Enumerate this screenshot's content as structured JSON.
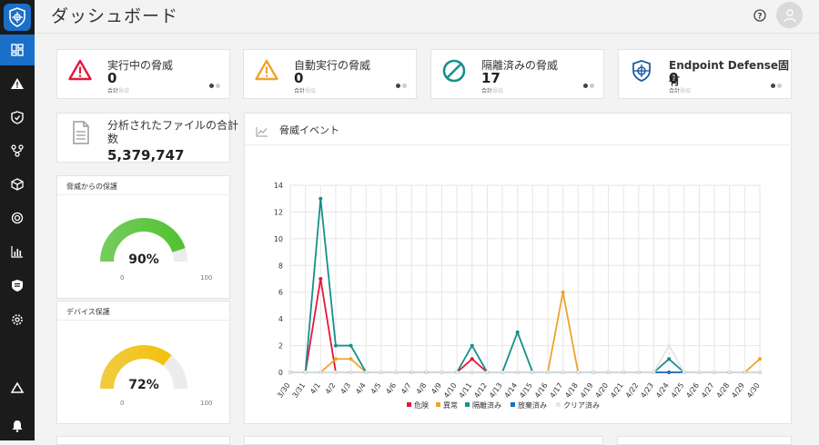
{
  "page": {
    "title": "ダッシュボード"
  },
  "stats": [
    {
      "label": "実行中の脅威",
      "value": "0",
      "sub": "合計",
      "sub_faded": "脅威",
      "icon": "alert-triangle-icon",
      "color": "#e5173d"
    },
    {
      "label": "自動実行の脅威",
      "value": "0",
      "sub": "合計",
      "sub_faded": "脅威",
      "icon": "warning-triangle-icon",
      "color": "#f0a32c"
    },
    {
      "label": "隔離済みの脅威",
      "value": "17",
      "sub": "合計",
      "sub_faded": "脅威",
      "icon": "prohibited-icon",
      "color": "#169089"
    },
    {
      "label": "Endpoint Defense固有",
      "value": "0",
      "sub": "合計",
      "sub_faded": "脅威",
      "icon": "shield-target-icon",
      "color": "#1f5aa8"
    }
  ],
  "files": {
    "label": "分析されたファイルの合計数",
    "value": "5,379,747"
  },
  "gauges": [
    {
      "title": "脅威からの保護",
      "value_text": "90%",
      "value": 0.9,
      "min": "0",
      "max": "100",
      "color": "#4fc22f"
    },
    {
      "title": "デバイス保護",
      "value_text": "72%",
      "value": 0.72,
      "min": "0",
      "max": "100",
      "color": "#f2c10a"
    }
  ],
  "chart": {
    "title": "脅威イベント"
  },
  "chart_data": {
    "type": "line",
    "categories": [
      "3/30",
      "3/31",
      "4/1",
      "4/2",
      "4/3",
      "4/4",
      "4/5",
      "4/6",
      "4/7",
      "4/8",
      "4/9",
      "4/10",
      "4/11",
      "4/12",
      "4/13",
      "4/14",
      "4/15",
      "4/16",
      "4/17",
      "4/18",
      "4/19",
      "4/20",
      "4/21",
      "4/22",
      "4/23",
      "4/24",
      "4/25",
      "4/26",
      "4/27",
      "4/28",
      "4/29",
      "4/30"
    ],
    "yticks": [
      0,
      2,
      4,
      6,
      8,
      10,
      12,
      14
    ],
    "ylim": [
      0,
      14
    ],
    "grid": true,
    "legend_position": "bottom",
    "series": [
      {
        "name": "危険",
        "color": "#e5173d",
        "values": [
          0,
          0,
          7,
          0,
          0,
          0,
          0,
          0,
          0,
          0,
          0,
          0,
          1,
          0,
          0,
          0,
          0,
          0,
          0,
          0,
          0,
          0,
          0,
          0,
          0,
          0,
          0,
          0,
          0,
          0,
          0,
          0
        ]
      },
      {
        "name": "異常",
        "color": "#f0a32c",
        "values": [
          0,
          0,
          0,
          1,
          1,
          0,
          0,
          0,
          0,
          0,
          0,
          0,
          0,
          0,
          0,
          0,
          0,
          0,
          6,
          0,
          0,
          0,
          0,
          0,
          0,
          0,
          0,
          0,
          0,
          0,
          0,
          1
        ]
      },
      {
        "name": "隔離済み",
        "color": "#169089",
        "values": [
          0,
          0,
          13,
          2,
          2,
          0,
          0,
          0,
          0,
          0,
          0,
          0,
          2,
          0,
          0,
          3,
          0,
          0,
          0,
          0,
          0,
          0,
          0,
          0,
          0,
          1,
          0,
          0,
          0,
          0,
          0,
          0
        ]
      },
      {
        "name": "放棄済み",
        "color": "#1a70c8",
        "values": [
          0,
          0,
          0,
          0,
          0,
          0,
          0,
          0,
          0,
          0,
          0,
          0,
          0,
          0,
          0,
          0,
          0,
          0,
          0,
          0,
          0,
          0,
          0,
          0,
          0,
          0,
          0,
          0,
          0,
          0,
          0,
          0
        ]
      },
      {
        "name": "クリア済み",
        "color": "#e6e6e6",
        "values": [
          0,
          0,
          0,
          0,
          0,
          0,
          0,
          0,
          0,
          0,
          0,
          0,
          0,
          0,
          0,
          0,
          0,
          0,
          0,
          0,
          0,
          0,
          0,
          0,
          0,
          2,
          0,
          0,
          0,
          0,
          0,
          0
        ]
      }
    ]
  }
}
